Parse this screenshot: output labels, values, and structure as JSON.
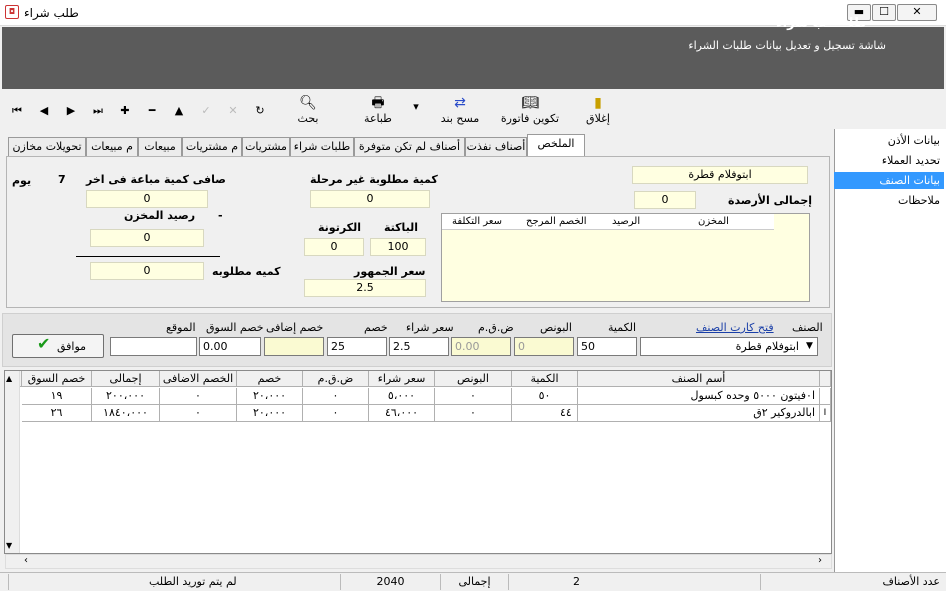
{
  "window": {
    "title": "طلب شراء",
    "minimize": "▬",
    "maximize": "☐",
    "close": "✕"
  },
  "banner": {
    "title": "طلـــــب شراء",
    "subtitle": "شاشة تسجيل و تعديل بيانات طلبات الشراء"
  },
  "toolbar": {
    "nav": [
      "⏮",
      "◀",
      "▶",
      "⏭",
      "✚",
      "━",
      "▲",
      "✓",
      "✕",
      "↻"
    ],
    "buttons": [
      {
        "label": "بحث",
        "icon": "search-icon"
      },
      {
        "label": "طباعة",
        "icon": "print-icon"
      },
      {
        "label": "مسح بند",
        "icon": "delete-item-icon"
      },
      {
        "label": "تكوين فاتورة",
        "icon": "invoice-icon"
      },
      {
        "label": "إغلاق",
        "icon": "exit-door-icon"
      }
    ]
  },
  "tabs": [
    "الملخص",
    "أصناف نفذت",
    "أصناف لم تكن متوفرة",
    "طلبات شراء",
    "مشتريات",
    "م مشتريات",
    "مبيعات",
    "م مبيعات",
    "تحويلات مخازن"
  ],
  "summary": {
    "item_name": "ابتوفلام قطرة",
    "total_balances_label": "إجمالى الأرصدة",
    "total_balances": "0",
    "qty_not_available_label": "كمية مطلوبة غير مرحلة",
    "qty_not_available": "0",
    "carton_label": "الكرتونة",
    "carton": "0",
    "pack_label": "الباكتة",
    "pack": "100",
    "public_price_label": "سعر الجمهور",
    "public_price": "2.5",
    "net_sold_label": "صافى كمية مباعة فى اخر",
    "net_sold_days": "7",
    "days_label": "يوم",
    "net_sold": "0",
    "store_balance_label": "رصيد المخزن",
    "store_balance_dash": "-",
    "store_balance": "0",
    "required_qty_label": "كميه مطلوبه",
    "required_qty": "0",
    "balance_table_headers": [
      "المخزن",
      "الرصيد",
      "الخصم المرجح",
      "سعر التكلفة"
    ]
  },
  "side_panel": {
    "items": [
      {
        "label": "بيانات الأذن",
        "selected": false
      },
      {
        "label": "تحديد العملاء",
        "selected": false
      },
      {
        "label": "بيانات الصنف",
        "selected": true
      },
      {
        "label": "ملاحظات",
        "selected": false
      }
    ]
  },
  "entry": {
    "headers": {
      "item": "الصنف",
      "item_card_link": "فتح كارت الصنف",
      "qty": "الكمية",
      "bonus": "البونص",
      "vat": "ض.ق.م",
      "buy_price": "سعر شراء",
      "discount": "خصم",
      "extra_discount": "خصم إضافى",
      "market_discount": "خصم السوق",
      "location": "الموقع"
    },
    "values": {
      "item": "ابتوفلام قطرة",
      "qty": "50",
      "bonus": "0",
      "vat": "0.00",
      "buy_price": "2.5",
      "discount": "25",
      "extra_discount": "",
      "market_discount": "0.00",
      "location": ""
    },
    "ok_label": "موافق"
  },
  "grid": {
    "headers": [
      "أسم الصنف",
      "الكمية",
      "البونص",
      "سعر شراء",
      "ض.ق.م",
      "خصم",
      "الخصم الاضافى",
      "إجمالى",
      "خصم السوق"
    ],
    "rows": [
      [
        "ا٠فيتون ٥٠٠٠ وحده كبسول",
        "٥٠",
        "٠",
        "٥،٠٠٠",
        "٠",
        "٢٠،٠٠٠",
        "٠",
        "٢٠٠،٠٠٠",
        "١٩"
      ],
      [
        "ابالدروكير ٢ق",
        "٤٤",
        "٠",
        "٤٦،٠٠٠",
        "٠",
        "٢٠،٠٠٠",
        "٠",
        "١٨٤٠،٠٠٠",
        "٢٦"
      ]
    ]
  },
  "status": {
    "items_count_label": "عدد الأصناف",
    "items_count": "2",
    "total_label": "إجمالى",
    "total": "2040",
    "supply_status": "لم يتم توريد الطلب"
  },
  "colors": {
    "banner": "#5b5b5b",
    "field_yellow": "#ffffe1",
    "selection_blue": "#3399ff",
    "ok_check": "#1a9a1a"
  }
}
